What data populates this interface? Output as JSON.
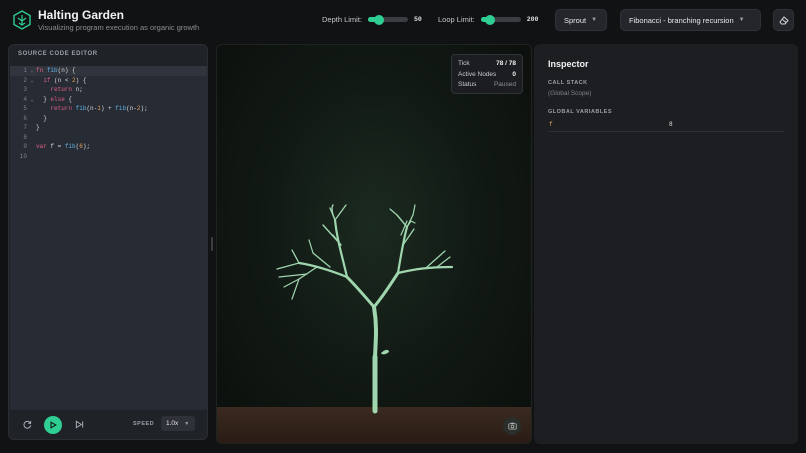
{
  "header": {
    "title": "Halting Garden",
    "subtitle": "Visualizing program execution as organic growth",
    "depth_label": "Depth Limit:",
    "depth_value": "50",
    "depth_fraction": 0.25,
    "loop_label": "Loop Limit:",
    "loop_value": "200",
    "loop_fraction": 0.2,
    "style_select": "Sprout",
    "example_select": "Fibonacci - branching recursion",
    "clear_icon": "eraser-icon"
  },
  "editor": {
    "heading": "SOURCE CODE EDITOR",
    "lines": [
      {
        "n": "1",
        "fold": "⌄",
        "indent": "",
        "tokens": [
          {
            "t": "fn ",
            "c": "kw"
          },
          {
            "t": "fib",
            "c": "fn"
          },
          {
            "t": "(n) {",
            "c": ""
          }
        ]
      },
      {
        "n": "2",
        "fold": "⌄",
        "indent": "  ",
        "tokens": [
          {
            "t": "if ",
            "c": "kw"
          },
          {
            "t": "(n < ",
            "c": ""
          },
          {
            "t": "2",
            "c": "num"
          },
          {
            "t": ") {",
            "c": ""
          }
        ]
      },
      {
        "n": "3",
        "fold": "",
        "indent": "    ",
        "tokens": [
          {
            "t": "return ",
            "c": "kw"
          },
          {
            "t": "n;",
            "c": ""
          }
        ]
      },
      {
        "n": "4",
        "fold": "⌄",
        "indent": "  ",
        "tokens": [
          {
            "t": "} ",
            "c": ""
          },
          {
            "t": "else",
            "c": "kw"
          },
          {
            "t": " {",
            "c": ""
          }
        ]
      },
      {
        "n": "5",
        "fold": "",
        "indent": "    ",
        "tokens": [
          {
            "t": "return ",
            "c": "kw"
          },
          {
            "t": "fib",
            "c": "fn"
          },
          {
            "t": "(n-",
            "c": ""
          },
          {
            "t": "1",
            "c": "num"
          },
          {
            "t": ") + ",
            "c": ""
          },
          {
            "t": "fib",
            "c": "fn"
          },
          {
            "t": "(n-",
            "c": ""
          },
          {
            "t": "2",
            "c": "num"
          },
          {
            "t": ");",
            "c": ""
          }
        ]
      },
      {
        "n": "6",
        "fold": "",
        "indent": "  ",
        "tokens": [
          {
            "t": "}",
            "c": ""
          }
        ]
      },
      {
        "n": "7",
        "fold": "",
        "indent": "",
        "tokens": [
          {
            "t": "}",
            "c": ""
          }
        ]
      },
      {
        "n": "8",
        "fold": "",
        "indent": "",
        "tokens": []
      },
      {
        "n": "9",
        "fold": "",
        "indent": "",
        "tokens": [
          {
            "t": "var ",
            "c": "kw"
          },
          {
            "t": "f = ",
            "c": ""
          },
          {
            "t": "fib",
            "c": "fn"
          },
          {
            "t": "(",
            "c": ""
          },
          {
            "t": "6",
            "c": "num"
          },
          {
            "t": ");",
            "c": ""
          }
        ]
      },
      {
        "n": "10",
        "fold": "",
        "indent": "",
        "tokens": []
      }
    ],
    "speed_label": "SPEED",
    "speed_value": "1.0x"
  },
  "canvas": {
    "tick_label": "Tick",
    "tick_value": "78 / 78",
    "nodes_label": "Active Nodes",
    "nodes_value": "0",
    "status_label": "Status",
    "status_value": "Paused"
  },
  "inspector": {
    "title": "Inspector",
    "call_stack_heading": "CALL STACK",
    "call_stack_scope": "(Global Scope)",
    "globals_heading": "GLOBAL VARIABLES",
    "globals": [
      {
        "name": "f",
        "value": "8"
      }
    ]
  },
  "colors": {
    "accent": "#2fcf94",
    "branch": "#9fd6ae",
    "keyword": "#e0608a",
    "function": "#5fb3e6",
    "number": "#e8a35a"
  }
}
